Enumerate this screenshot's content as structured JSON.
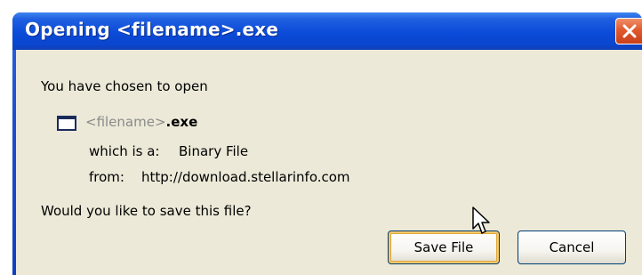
{
  "window": {
    "title": "Opening <filename>.exe"
  },
  "dialog": {
    "intro": "You have chosen to open",
    "file": {
      "name_tag": "<filename>",
      "name_ext": ".exe",
      "type_label": "which is a:",
      "type_value": "Binary File",
      "from_label": "from:",
      "from_value": "http://download.stellarinfo.com"
    },
    "question": "Would you like to save this file?"
  },
  "buttons": {
    "save": "Save File",
    "cancel": "Cancel"
  },
  "colors": {
    "titlebar": "#0b4bd8",
    "client_bg": "#ece9d8",
    "close_button": "#e05a2e",
    "focus_ring": "#f6c96a"
  },
  "icons": {
    "file": "window-app-icon",
    "close": "close-x-icon",
    "cursor": "arrow-cursor-icon"
  }
}
